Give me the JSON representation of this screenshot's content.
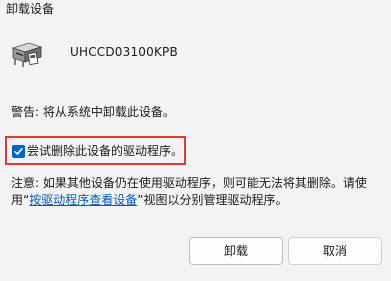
{
  "window": {
    "title": "卸载设备"
  },
  "device": {
    "icon": "card-reader-device-icon",
    "name": "UHCCD03100KPB"
  },
  "warning_text": "警告: 将从系统中卸载此设备。",
  "checkbox": {
    "label": "尝试删除此设备的驱动程序。",
    "checked": true,
    "highlight_color": "#e0393e"
  },
  "note": {
    "prefix": "注意: 如果其他设备仍在使用驱动程序，则可能无法将其删除。请使用“",
    "link_text": "按驱动程序查看设备",
    "suffix": "”视图以分别管理驱动程序。"
  },
  "buttons": {
    "uninstall_label": "卸载",
    "cancel_label": "取消"
  },
  "colors": {
    "accent": "#0067c0",
    "link": "#0a59b8"
  }
}
